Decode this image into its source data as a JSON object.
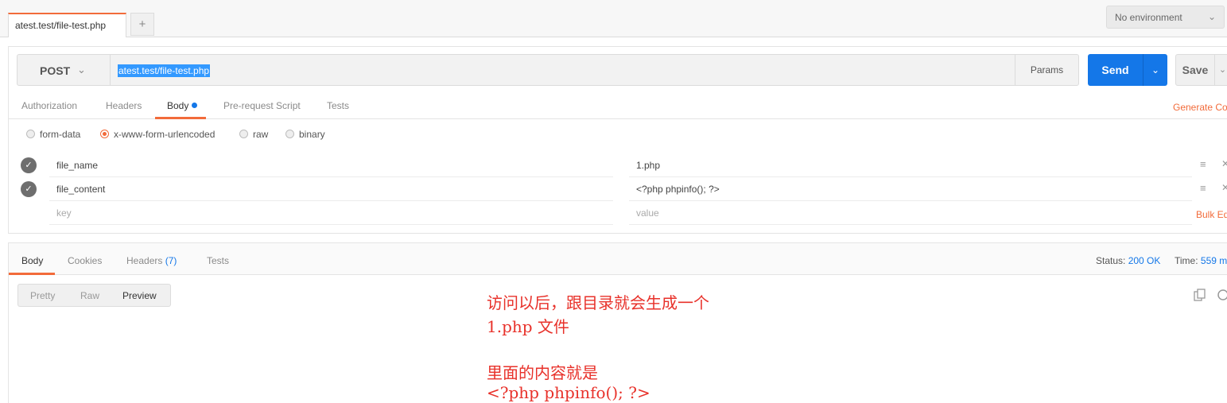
{
  "tabs": {
    "active_label": "atest.test/file-test.php",
    "add_label": "+"
  },
  "environment": {
    "label": "No environment"
  },
  "request": {
    "method": "POST",
    "url": "atest.test/file-test.php",
    "params_label": "Params",
    "send_label": "Send",
    "save_label": "Save",
    "tabs": [
      {
        "label": "Authorization"
      },
      {
        "label": "Headers"
      },
      {
        "label": "Body"
      },
      {
        "label": "Pre-request Script"
      },
      {
        "label": "Tests"
      }
    ],
    "generate_code_label": "Generate Co",
    "body_types": [
      {
        "label": "form-data",
        "selected": false
      },
      {
        "label": "x-www-form-urlencoded",
        "selected": true
      },
      {
        "label": "raw",
        "selected": false
      },
      {
        "label": "binary",
        "selected": false
      }
    ],
    "rows": [
      {
        "key": "file_name",
        "value": "1.php"
      },
      {
        "key": "file_content",
        "value": "<?php phpinfo(); ?>"
      }
    ],
    "key_placeholder": "key",
    "value_placeholder": "value",
    "bulk_edit_label": "Bulk Ed"
  },
  "response": {
    "tabs": [
      {
        "label": "Body"
      },
      {
        "label": "Cookies"
      },
      {
        "label": "Headers"
      },
      {
        "label": "Tests"
      }
    ],
    "headers_count": "(7)",
    "status_label": "Status:",
    "status_value": "200 OK",
    "time_label": "Time:",
    "time_value": "559 m",
    "view_modes": [
      {
        "label": "Pretty"
      },
      {
        "label": "Raw"
      },
      {
        "label": "Preview"
      }
    ]
  },
  "annotation": {
    "lines": [
      "访问以后，跟目录就会生成一个",
      "1.php 文件",
      "里面的内容就是",
      "<?php phpinfo(); ?>"
    ]
  },
  "colors": {
    "accent": "#f26b3a",
    "primary": "#1477e8",
    "annotation": "#e8312a"
  },
  "icons": [
    "chevron-down-icon",
    "check-icon",
    "menu-icon",
    "close-icon",
    "copy-icon",
    "search-icon"
  ]
}
